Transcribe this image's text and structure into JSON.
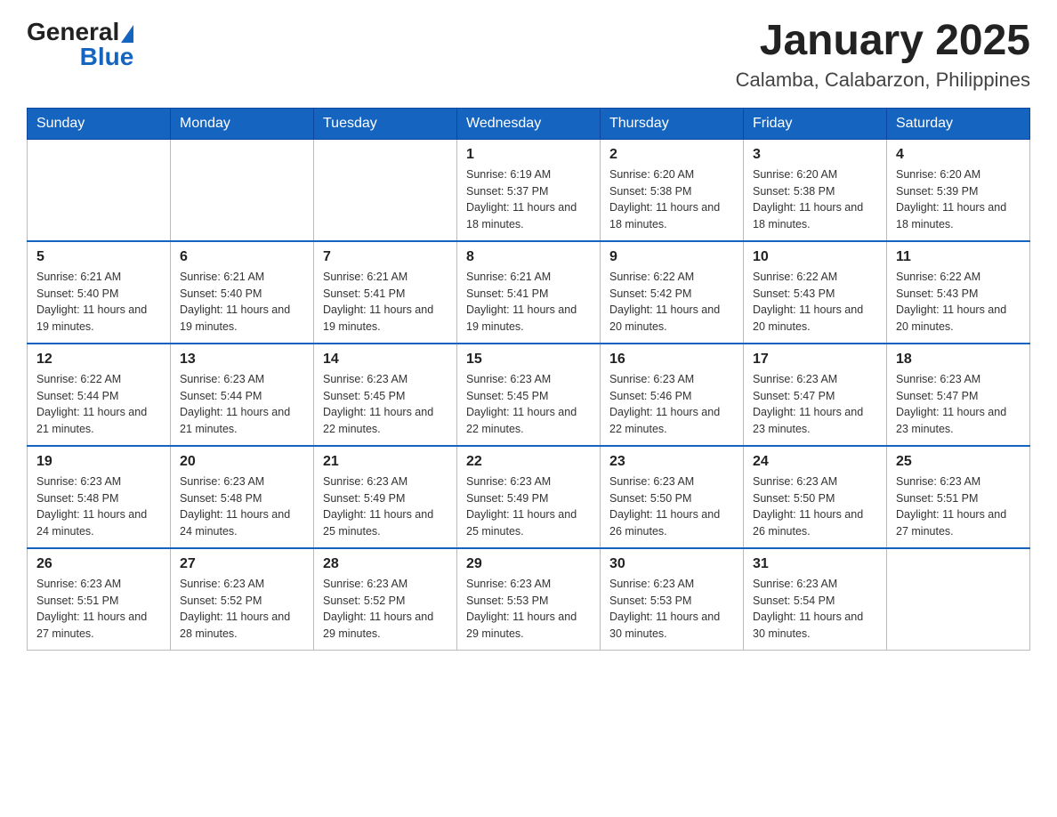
{
  "logo": {
    "text_general": "General",
    "text_blue": "Blue",
    "aria": "GeneralBlue logo"
  },
  "header": {
    "title": "January 2025",
    "subtitle": "Calamba, Calabarzon, Philippines"
  },
  "weekdays": [
    "Sunday",
    "Monday",
    "Tuesday",
    "Wednesday",
    "Thursday",
    "Friday",
    "Saturday"
  ],
  "weeks": [
    [
      {
        "day": "",
        "info": ""
      },
      {
        "day": "",
        "info": ""
      },
      {
        "day": "",
        "info": ""
      },
      {
        "day": "1",
        "info": "Sunrise: 6:19 AM\nSunset: 5:37 PM\nDaylight: 11 hours and 18 minutes."
      },
      {
        "day": "2",
        "info": "Sunrise: 6:20 AM\nSunset: 5:38 PM\nDaylight: 11 hours and 18 minutes."
      },
      {
        "day": "3",
        "info": "Sunrise: 6:20 AM\nSunset: 5:38 PM\nDaylight: 11 hours and 18 minutes."
      },
      {
        "day": "4",
        "info": "Sunrise: 6:20 AM\nSunset: 5:39 PM\nDaylight: 11 hours and 18 minutes."
      }
    ],
    [
      {
        "day": "5",
        "info": "Sunrise: 6:21 AM\nSunset: 5:40 PM\nDaylight: 11 hours and 19 minutes."
      },
      {
        "day": "6",
        "info": "Sunrise: 6:21 AM\nSunset: 5:40 PM\nDaylight: 11 hours and 19 minutes."
      },
      {
        "day": "7",
        "info": "Sunrise: 6:21 AM\nSunset: 5:41 PM\nDaylight: 11 hours and 19 minutes."
      },
      {
        "day": "8",
        "info": "Sunrise: 6:21 AM\nSunset: 5:41 PM\nDaylight: 11 hours and 19 minutes."
      },
      {
        "day": "9",
        "info": "Sunrise: 6:22 AM\nSunset: 5:42 PM\nDaylight: 11 hours and 20 minutes."
      },
      {
        "day": "10",
        "info": "Sunrise: 6:22 AM\nSunset: 5:43 PM\nDaylight: 11 hours and 20 minutes."
      },
      {
        "day": "11",
        "info": "Sunrise: 6:22 AM\nSunset: 5:43 PM\nDaylight: 11 hours and 20 minutes."
      }
    ],
    [
      {
        "day": "12",
        "info": "Sunrise: 6:22 AM\nSunset: 5:44 PM\nDaylight: 11 hours and 21 minutes."
      },
      {
        "day": "13",
        "info": "Sunrise: 6:23 AM\nSunset: 5:44 PM\nDaylight: 11 hours and 21 minutes."
      },
      {
        "day": "14",
        "info": "Sunrise: 6:23 AM\nSunset: 5:45 PM\nDaylight: 11 hours and 22 minutes."
      },
      {
        "day": "15",
        "info": "Sunrise: 6:23 AM\nSunset: 5:45 PM\nDaylight: 11 hours and 22 minutes."
      },
      {
        "day": "16",
        "info": "Sunrise: 6:23 AM\nSunset: 5:46 PM\nDaylight: 11 hours and 22 minutes."
      },
      {
        "day": "17",
        "info": "Sunrise: 6:23 AM\nSunset: 5:47 PM\nDaylight: 11 hours and 23 minutes."
      },
      {
        "day": "18",
        "info": "Sunrise: 6:23 AM\nSunset: 5:47 PM\nDaylight: 11 hours and 23 minutes."
      }
    ],
    [
      {
        "day": "19",
        "info": "Sunrise: 6:23 AM\nSunset: 5:48 PM\nDaylight: 11 hours and 24 minutes."
      },
      {
        "day": "20",
        "info": "Sunrise: 6:23 AM\nSunset: 5:48 PM\nDaylight: 11 hours and 24 minutes."
      },
      {
        "day": "21",
        "info": "Sunrise: 6:23 AM\nSunset: 5:49 PM\nDaylight: 11 hours and 25 minutes."
      },
      {
        "day": "22",
        "info": "Sunrise: 6:23 AM\nSunset: 5:49 PM\nDaylight: 11 hours and 25 minutes."
      },
      {
        "day": "23",
        "info": "Sunrise: 6:23 AM\nSunset: 5:50 PM\nDaylight: 11 hours and 26 minutes."
      },
      {
        "day": "24",
        "info": "Sunrise: 6:23 AM\nSunset: 5:50 PM\nDaylight: 11 hours and 26 minutes."
      },
      {
        "day": "25",
        "info": "Sunrise: 6:23 AM\nSunset: 5:51 PM\nDaylight: 11 hours and 27 minutes."
      }
    ],
    [
      {
        "day": "26",
        "info": "Sunrise: 6:23 AM\nSunset: 5:51 PM\nDaylight: 11 hours and 27 minutes."
      },
      {
        "day": "27",
        "info": "Sunrise: 6:23 AM\nSunset: 5:52 PM\nDaylight: 11 hours and 28 minutes."
      },
      {
        "day": "28",
        "info": "Sunrise: 6:23 AM\nSunset: 5:52 PM\nDaylight: 11 hours and 29 minutes."
      },
      {
        "day": "29",
        "info": "Sunrise: 6:23 AM\nSunset: 5:53 PM\nDaylight: 11 hours and 29 minutes."
      },
      {
        "day": "30",
        "info": "Sunrise: 6:23 AM\nSunset: 5:53 PM\nDaylight: 11 hours and 30 minutes."
      },
      {
        "day": "31",
        "info": "Sunrise: 6:23 AM\nSunset: 5:54 PM\nDaylight: 11 hours and 30 minutes."
      },
      {
        "day": "",
        "info": ""
      }
    ]
  ]
}
